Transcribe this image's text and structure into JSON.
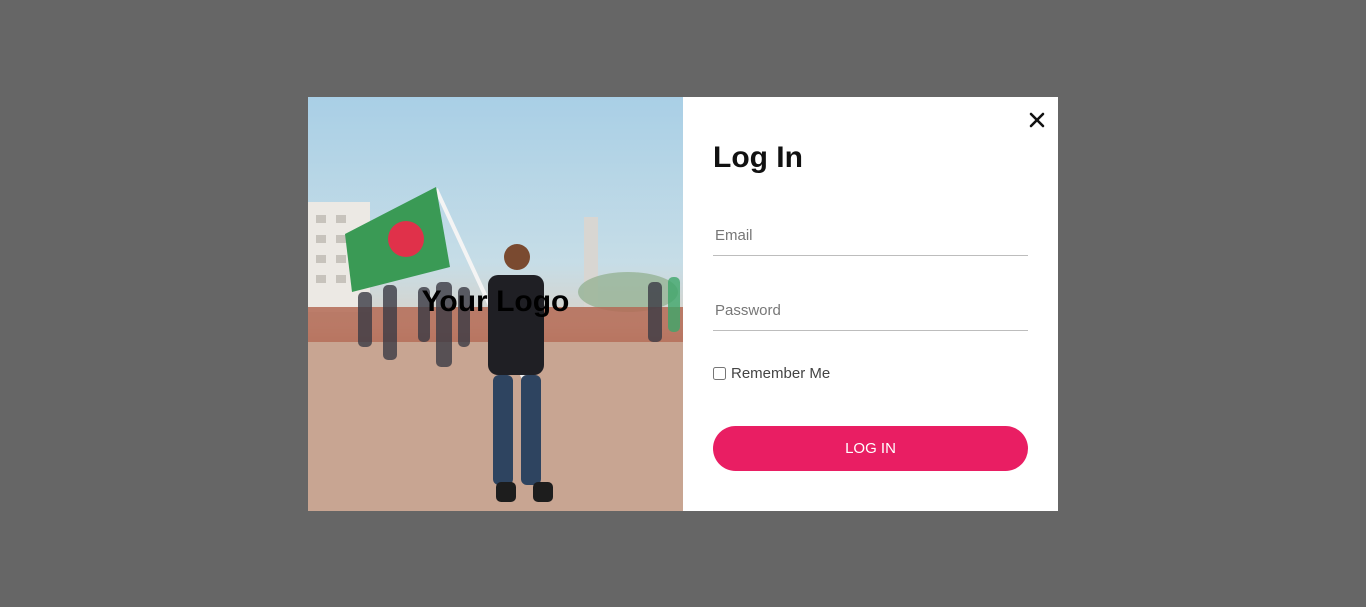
{
  "overlay": {
    "background_color": "#666666"
  },
  "photo": {
    "logo_text": "Your Logo",
    "flag_colors": {
      "green": "#3a9a55",
      "red": "#e0314a"
    }
  },
  "login": {
    "title": "Log In",
    "close_icon": "close-icon",
    "email_placeholder": "Email",
    "email_value": "",
    "password_placeholder": "Password",
    "password_value": "",
    "remember_label": "Remember Me",
    "remember_checked": false,
    "submit_label": "LOG IN",
    "accent_color": "#e91e63"
  }
}
